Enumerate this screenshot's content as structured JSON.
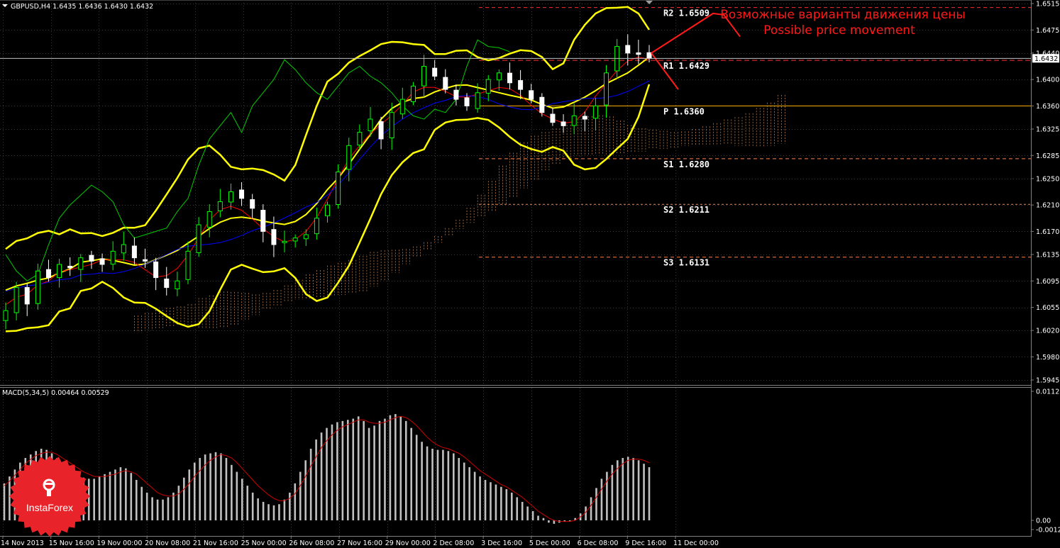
{
  "header": {
    "title": "GBPUSD,H4  1.6435 1.6436 1.6430 1.6432",
    "macd_title": "MACD(5,34,5) 0.00464 0.00529"
  },
  "annotations": {
    "ru": "Возможные варианты движения цены",
    "en": "Possible price movement"
  },
  "logo": {
    "text": "InstaForex"
  },
  "colors": {
    "background": "#000000",
    "grid": "#3a3a3a",
    "bull": "#00ff00",
    "bear": "#ffffff",
    "bollinger": "#ffff00",
    "tenkan": "#ff0000",
    "kijun": "#0000ff",
    "chikou": "#00cc00",
    "cloud": "#f4a460",
    "annotation": "#ff1a1a",
    "macd_hist": "#c0c0c0",
    "macd_signal": "#cc0000",
    "price_line": "#c0c0c0"
  },
  "chart_data": [
    {
      "type": "candlestick",
      "symbol": "GBPUSD",
      "timeframe": "H4",
      "ylim": [
        1.5945,
        1.6515
      ],
      "y_ticks": [
        "1.6515",
        "1.6475",
        "1.6440",
        "1.6400",
        "1.6360",
        "1.6325",
        "1.6285",
        "1.6250",
        "1.6210",
        "1.6170",
        "1.6135",
        "1.6095",
        "1.6055",
        "1.6020",
        "1.5980",
        "1.5945"
      ],
      "current_price": "1.6432",
      "x_ticks": [
        "14 Nov 2013",
        "15 Nov 16:00",
        "19 Nov 00:00",
        "20 Nov 08:00",
        "21 Nov 16:00",
        "25 Nov 00:00",
        "26 Nov 08:00",
        "27 Nov 16:00",
        "29 Nov 00:00",
        "2 Dec 08:00",
        "3 Dec 16:00",
        "5 Dec 00:00",
        "6 Dec 08:00",
        "9 Dec 16:00",
        "11 Dec 00:00"
      ],
      "pivots": [
        {
          "label": "R2",
          "value": "1.6509",
          "v": 1.6509,
          "color": "#ff3030",
          "dash": "5,4"
        },
        {
          "label": "R1",
          "value": "1.6429",
          "v": 1.6429,
          "color": "#ff3030",
          "dash": "7,4"
        },
        {
          "label": "P",
          "value": "1.6360",
          "v": 1.636,
          "color": "#ffb000",
          "dash": ""
        },
        {
          "label": "S1",
          "value": "1.6280",
          "v": 1.628,
          "color": "#ff8040",
          "dash": "5,4"
        },
        {
          "label": "S2",
          "value": "1.6211",
          "v": 1.6211,
          "color": "#ff8040",
          "dash": "3,3"
        },
        {
          "label": "S3",
          "value": "1.6131",
          "v": 1.6131,
          "color": "#ff8040",
          "dash": "5,4"
        }
      ],
      "close_path": [
        1.605,
        1.6085,
        1.606,
        1.611,
        1.61,
        1.612,
        1.6115,
        1.613,
        1.6125,
        1.612,
        1.614,
        1.615,
        1.613,
        1.6125,
        1.61,
        1.6085,
        1.6095,
        1.614,
        1.618,
        1.62,
        1.6215,
        1.623,
        1.622,
        1.6205,
        1.617,
        1.615,
        1.6155,
        1.616,
        1.6165,
        1.619,
        1.621,
        1.626,
        1.63,
        1.632,
        1.634,
        1.631,
        1.635,
        1.637,
        1.639,
        1.642,
        1.6405,
        1.6385,
        1.637,
        1.636,
        1.638,
        1.64,
        1.641,
        1.6395,
        1.6385,
        1.637,
        1.635,
        1.6335,
        1.633,
        1.6345,
        1.634,
        1.636,
        1.641,
        1.645,
        1.644,
        1.6438,
        1.6432
      ]
    },
    {
      "type": "histogram",
      "name": "MACD(5,34,5)",
      "ylim": [
        -0.0003,
        0.01123
      ],
      "y_ticks": [
        "0.01123",
        "0.00",
        "-0.00123"
      ],
      "values": [
        0.0032,
        0.0038,
        0.0044,
        0.005,
        0.0054,
        0.0057,
        0.006,
        0.0062,
        0.0061,
        0.0058,
        0.0054,
        0.005,
        0.0046,
        0.0042,
        0.0039,
        0.0037,
        0.0036,
        0.0036,
        0.0038,
        0.004,
        0.0042,
        0.0044,
        0.0046,
        0.0045,
        0.0041,
        0.0035,
        0.0029,
        0.0024,
        0.002,
        0.0018,
        0.0018,
        0.002,
        0.0024,
        0.003,
        0.0037,
        0.0044,
        0.005,
        0.0054,
        0.0057,
        0.0058,
        0.0059,
        0.0058,
        0.0054,
        0.0048,
        0.0042,
        0.0036,
        0.003,
        0.0024,
        0.0019,
        0.0016,
        0.0014,
        0.0013,
        0.0014,
        0.0018,
        0.0024,
        0.0032,
        0.0042,
        0.0052,
        0.0062,
        0.007,
        0.0076,
        0.008,
        0.0083,
        0.0085,
        0.0086,
        0.0087,
        0.0088,
        0.009,
        0.0086,
        0.008,
        0.0082,
        0.0086,
        0.0088,
        0.0091,
        0.0092,
        0.009,
        0.0086,
        0.008,
        0.0074,
        0.0068,
        0.0064,
        0.0062,
        0.0061,
        0.0061,
        0.006,
        0.0058,
        0.0054,
        0.005,
        0.0046,
        0.0042,
        0.0038,
        0.0035,
        0.0033,
        0.0031,
        0.0029,
        0.0027,
        0.0024,
        0.002,
        0.0016,
        0.0012,
        0.0008,
        0.0004,
        0.0002,
        -0.0002,
        -0.0003,
        -0.0002,
        -0.0001,
        0.0,
        0.0002,
        0.0006,
        0.0012,
        0.002,
        0.0028,
        0.0036,
        0.0042,
        0.0048,
        0.0052,
        0.0054,
        0.0055,
        0.0054,
        0.0052,
        0.0049,
        0.0046
      ],
      "signal": [
        0.003,
        0.0034,
        0.0039,
        0.0044,
        0.0049,
        0.0053,
        0.0056,
        0.0058,
        0.0059,
        0.0059,
        0.0057,
        0.0054,
        0.0051,
        0.0048,
        0.0045,
        0.0042,
        0.004,
        0.0038,
        0.0038,
        0.0038,
        0.0039,
        0.004,
        0.0042,
        0.0043,
        0.0042,
        0.004,
        0.0036,
        0.0032,
        0.0028,
        0.0024,
        0.0022,
        0.0021,
        0.0021,
        0.0023,
        0.0027,
        0.0032,
        0.0038,
        0.0043,
        0.0048,
        0.0052,
        0.0055,
        0.0057,
        0.0056,
        0.0054,
        0.005,
        0.0045,
        0.004,
        0.0035,
        0.003,
        0.0026,
        0.0022,
        0.0019,
        0.0017,
        0.0017,
        0.0019,
        0.0023,
        0.003,
        0.0038,
        0.0047,
        0.0055,
        0.0063,
        0.0069,
        0.0074,
        0.0078,
        0.0081,
        0.0083,
        0.0085,
        0.0087,
        0.0087,
        0.0085,
        0.0084,
        0.0084,
        0.0085,
        0.0087,
        0.0089,
        0.009,
        0.0089,
        0.0086,
        0.0082,
        0.0077,
        0.0072,
        0.0068,
        0.0065,
        0.0063,
        0.0062,
        0.006,
        0.0058,
        0.0055,
        0.0051,
        0.0047,
        0.0043,
        0.004,
        0.0037,
        0.0034,
        0.0031,
        0.0029,
        0.0026,
        0.0023,
        0.002,
        0.0016,
        0.0012,
        0.0008,
        0.0005,
        0.0002,
        0.0,
        -0.0001,
        -0.0001,
        -0.0001,
        0.0,
        0.0003,
        0.0007,
        0.0013,
        0.002,
        0.0027,
        0.0034,
        0.004,
        0.0045,
        0.0049,
        0.0052,
        0.0053,
        0.0053,
        0.0052,
        0.005
      ]
    }
  ]
}
